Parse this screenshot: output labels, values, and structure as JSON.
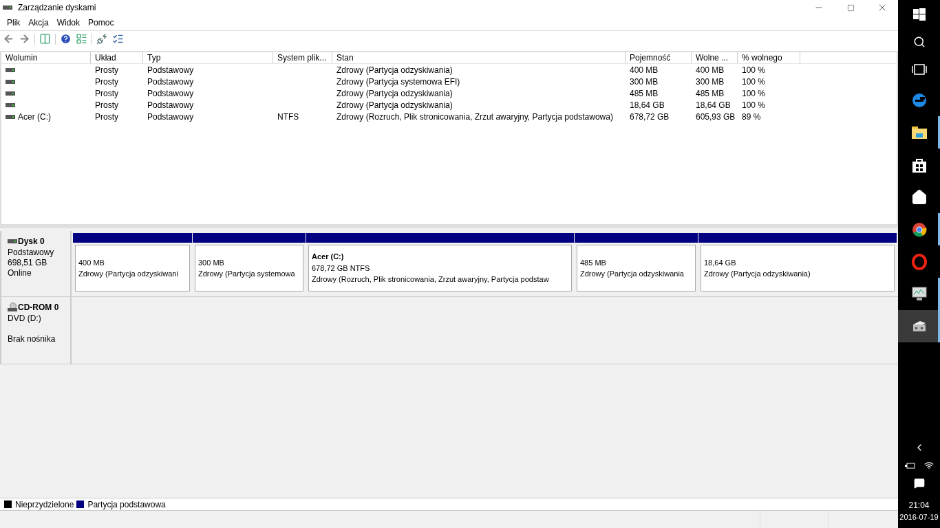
{
  "window": {
    "title": "Zarządzanie dyskami"
  },
  "menu": [
    "Plik",
    "Akcja",
    "Widok",
    "Pomoc"
  ],
  "table": {
    "columns": [
      "Wolumin",
      "Układ",
      "Typ",
      "System plik...",
      "Stan",
      "Pojemność",
      "Wolne ...",
      "% wolnego"
    ],
    "rows": [
      [
        "",
        "Prosty",
        "Podstawowy",
        "",
        "Zdrowy (Partycja odzyskiwania)",
        "400 MB",
        "400 MB",
        "100 %"
      ],
      [
        "",
        "Prosty",
        "Podstawowy",
        "",
        "Zdrowy (Partycja systemowa EFI)",
        "300 MB",
        "300 MB",
        "100 %"
      ],
      [
        "",
        "Prosty",
        "Podstawowy",
        "",
        "Zdrowy (Partycja odzyskiwania)",
        "485 MB",
        "485 MB",
        "100 %"
      ],
      [
        "",
        "Prosty",
        "Podstawowy",
        "",
        "Zdrowy (Partycja odzyskiwania)",
        "18,64 GB",
        "18,64 GB",
        "100 %"
      ],
      [
        "Acer (C:)",
        "Prosty",
        "Podstawowy",
        "NTFS",
        "Zdrowy (Rozruch, Plik stronicowania, Zrzut awaryjny, Partycja podstawowa)",
        "678,72 GB",
        "605,93 GB",
        "89 %"
      ]
    ]
  },
  "disks": [
    {
      "kind": "disk",
      "name": "Dysk 0",
      "lines": [
        "Podstawowy",
        "698,51 GB",
        "Online"
      ],
      "partitions": [
        {
          "color": "#000080",
          "size": "400 MB",
          "status": "Zdrowy (Partycja odzyskiwani"
        },
        {
          "color": "#000080",
          "size": "300 MB",
          "status": "Zdrowy (Partycja systemowa"
        },
        {
          "color": "#000080",
          "label": "Acer  (C:)",
          "size": "678,72 GB NTFS",
          "status": "Zdrowy (Rozruch, Plik stronicowania, Zrzut awaryjny, Partycja podstaw"
        },
        {
          "color": "#000080",
          "size": "485 MB",
          "status": "Zdrowy (Partycja odzyskiwania"
        },
        {
          "color": "#000080",
          "size": "18,64 GB",
          "status": "Zdrowy (Partycja odzyskiwania)"
        }
      ]
    },
    {
      "kind": "cdrom",
      "name": "CD-ROM 0",
      "lines": [
        "DVD (D:)",
        "Brak nośnika"
      ]
    }
  ],
  "legend": [
    {
      "label": "Nieprzydzielone",
      "color": "#000000"
    },
    {
      "label": "Partycja podstawowa",
      "color": "#000080"
    }
  ],
  "taskbar": {
    "items": [
      {
        "kind": "edge",
        "running": false,
        "selected": false
      },
      {
        "kind": "folder",
        "running": true,
        "selected": false
      },
      {
        "kind": "store",
        "running": false,
        "selected": false
      },
      {
        "kind": "home",
        "running": false,
        "selected": false
      },
      {
        "kind": "chrome",
        "running": true,
        "selected": false
      },
      {
        "kind": "opera",
        "running": false,
        "selected": false
      },
      {
        "kind": "monitor",
        "running": true,
        "selected": false
      },
      {
        "kind": "diskmgmt",
        "running": true,
        "selected": true
      }
    ],
    "time": "21:04",
    "date": "2016-07-19"
  }
}
